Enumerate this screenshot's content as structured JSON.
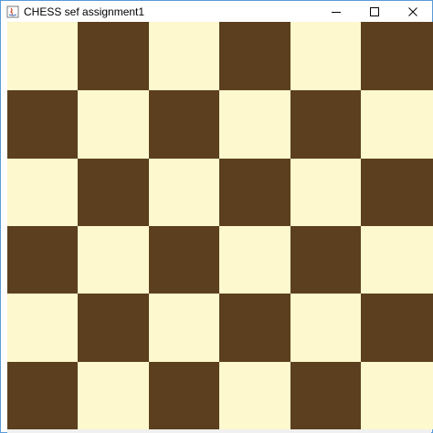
{
  "window": {
    "title": "CHESS sef assignment1",
    "app_icon": "java-app-icon",
    "controls": [
      "minimize-icon",
      "maximize-icon",
      "close-icon"
    ]
  },
  "board": {
    "rows": 6,
    "cols": 6,
    "light_color": "#fdf8cd",
    "dark_color": "#5c3f1e",
    "pattern": [
      [
        "light",
        "dark",
        "light",
        "dark",
        "light",
        "dark"
      ],
      [
        "dark",
        "light",
        "dark",
        "light",
        "dark",
        "light"
      ],
      [
        "light",
        "dark",
        "light",
        "dark",
        "light",
        "dark"
      ],
      [
        "dark",
        "light",
        "dark",
        "light",
        "dark",
        "light"
      ],
      [
        "light",
        "dark",
        "light",
        "dark",
        "light",
        "dark"
      ],
      [
        "dark",
        "light",
        "dark",
        "light",
        "dark",
        "light"
      ]
    ]
  }
}
